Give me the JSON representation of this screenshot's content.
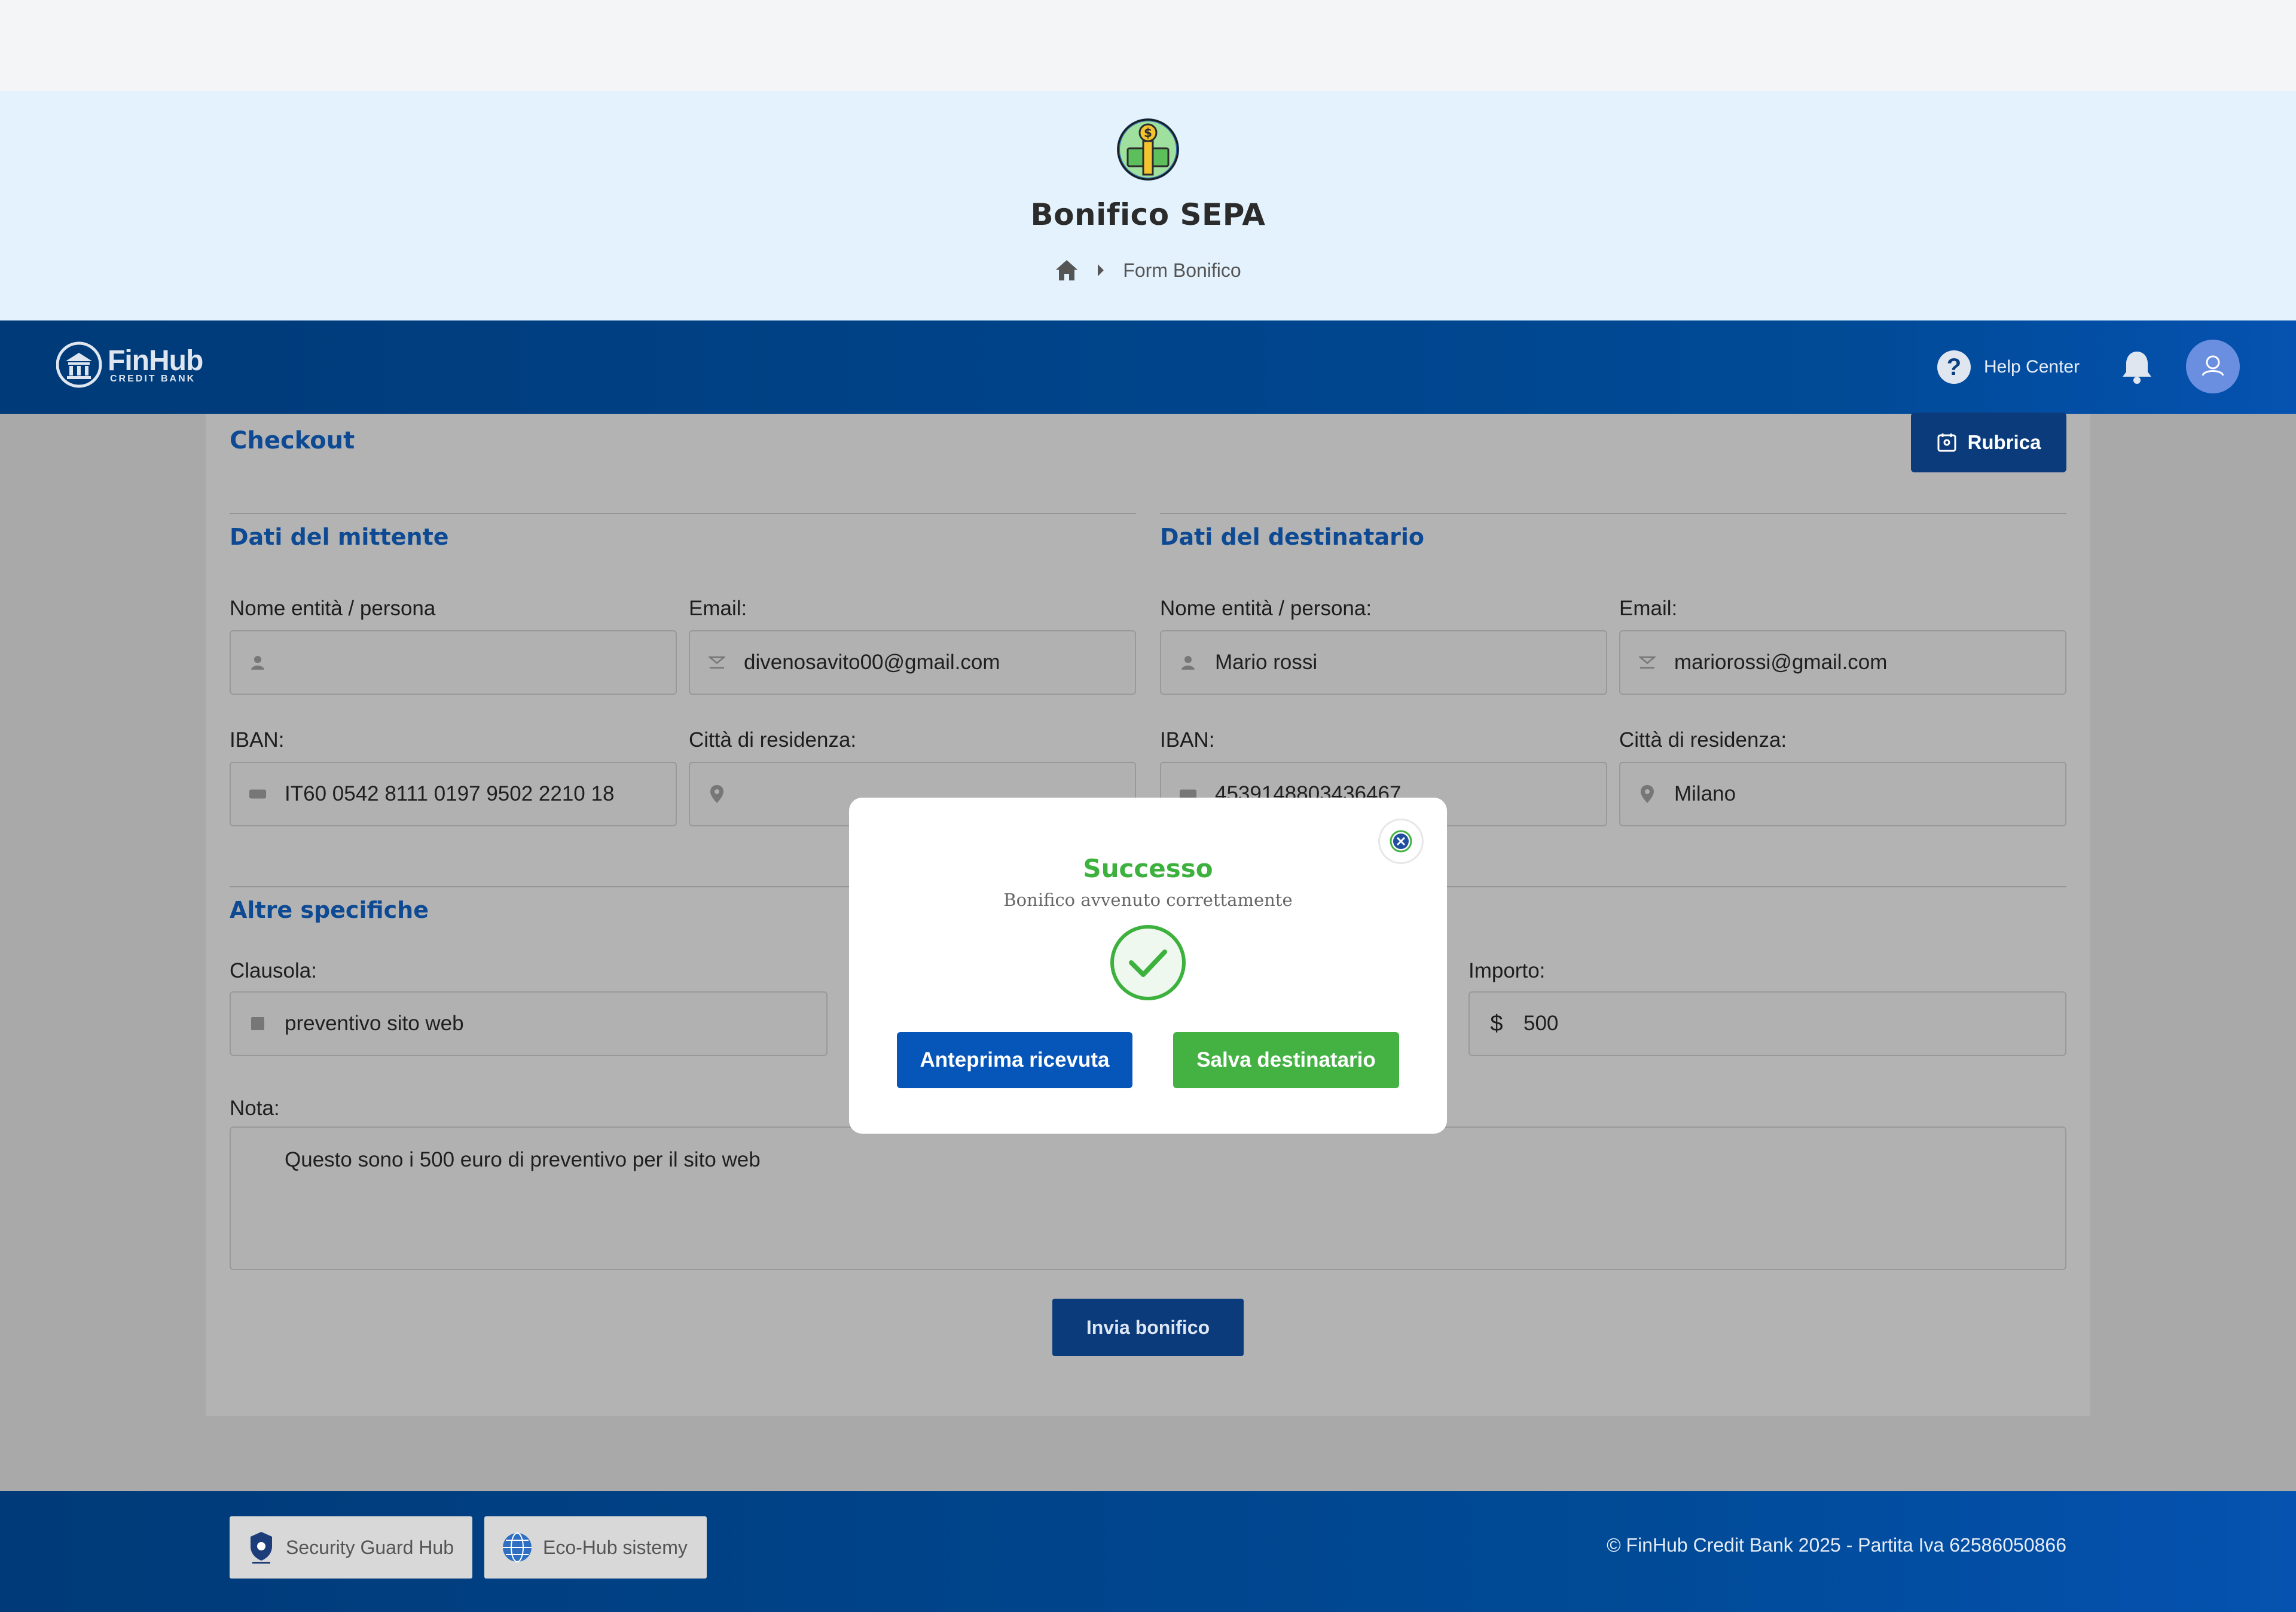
{
  "hero": {
    "title": "Bonifico SEPA",
    "breadcrumb_current": "Form Bonifico",
    "bg_color": "#e3f2fd"
  },
  "header": {
    "brand_name": "FinHub",
    "brand_sub": "CREDIT BANK",
    "help_label": "Help Center",
    "help_glyph": "?",
    "bg_color": "#004a96"
  },
  "form": {
    "title": "Checkout",
    "rubrica_label": "Rubrica",
    "sender": {
      "title": "Dati del mittente",
      "name_label": "Nome entità / persona",
      "name_value": "",
      "email_label": "Email:",
      "email_value": "divenosavito00@gmail.com",
      "iban_label": "IBAN:",
      "iban_value": "IT60 0542 8111 0197 9502 2210 18",
      "city_label": "Città di residenza:",
      "city_value": ""
    },
    "recipient": {
      "title": "Dati del destinatario",
      "name_label": "Nome entità / persona:",
      "name_value": "Mario rossi",
      "email_label": "Email:",
      "email_value": "mariorossi@gmail.com",
      "iban_label": "IBAN:",
      "iban_value": "4539148803436467",
      "city_label": "Città di residenza:",
      "city_value": "Milano"
    },
    "other": {
      "title": "Altre specifiche",
      "clause_label": "Clausola:",
      "clause_value": "preventivo sito web",
      "amount_label": "Importo:",
      "amount_symbol": "$",
      "amount_value": "500",
      "note_label": "Nota:",
      "note_value": "Questo sono i 500 euro di preventivo per il sito web"
    },
    "send_label": "Invia bonifico"
  },
  "modal": {
    "title": "Successo",
    "subtitle": "Bonifico avvenuto correttamente",
    "btn_receipt": "Anteprima ricevuta",
    "btn_save": "Salva destinatario",
    "success_color": "#3db13d",
    "primary_color": "#0655b8"
  },
  "footer": {
    "badge1": "Security Guard Hub",
    "badge2": "Eco-Hub sistemy",
    "copyright": "© FinHub Credit Bank 2025 - Partita Iva 62586050866"
  }
}
